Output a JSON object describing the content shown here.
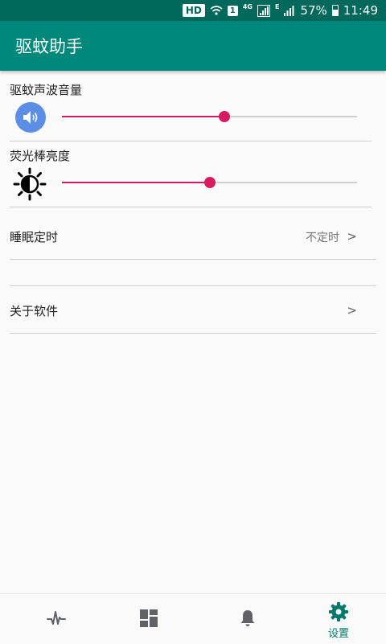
{
  "status_bar": {
    "hd": "HD",
    "sim": "1",
    "network_type": "4G",
    "network_type_2": "E",
    "battery_percent": "57%",
    "battery_level": 0.57,
    "time": "11:49"
  },
  "app_bar": {
    "title": "驱蚊助手"
  },
  "settings": {
    "volume": {
      "label": "驱蚊声波音量",
      "value": 0.55,
      "icon": "speaker-icon"
    },
    "brightness": {
      "label": "荧光棒亮度",
      "value": 0.5,
      "icon": "brightness-icon"
    },
    "sleep_timer": {
      "label": "睡眠定时",
      "value": "不定时",
      "chevron": ">"
    },
    "about": {
      "label": "关于软件",
      "chevron": ">"
    }
  },
  "bottom_nav": {
    "items": [
      {
        "icon": "pulse-icon",
        "label": ""
      },
      {
        "icon": "dashboard-icon",
        "label": ""
      },
      {
        "icon": "bell-icon",
        "label": ""
      },
      {
        "icon": "gear-icon",
        "label": "设置",
        "active": true
      }
    ]
  },
  "colors": {
    "status_bar": "#00695c",
    "app_bar": "#00897b",
    "accent": "#d81b60",
    "active_nav": "#00796b",
    "volume_icon_bg": "#5c8ee6"
  }
}
